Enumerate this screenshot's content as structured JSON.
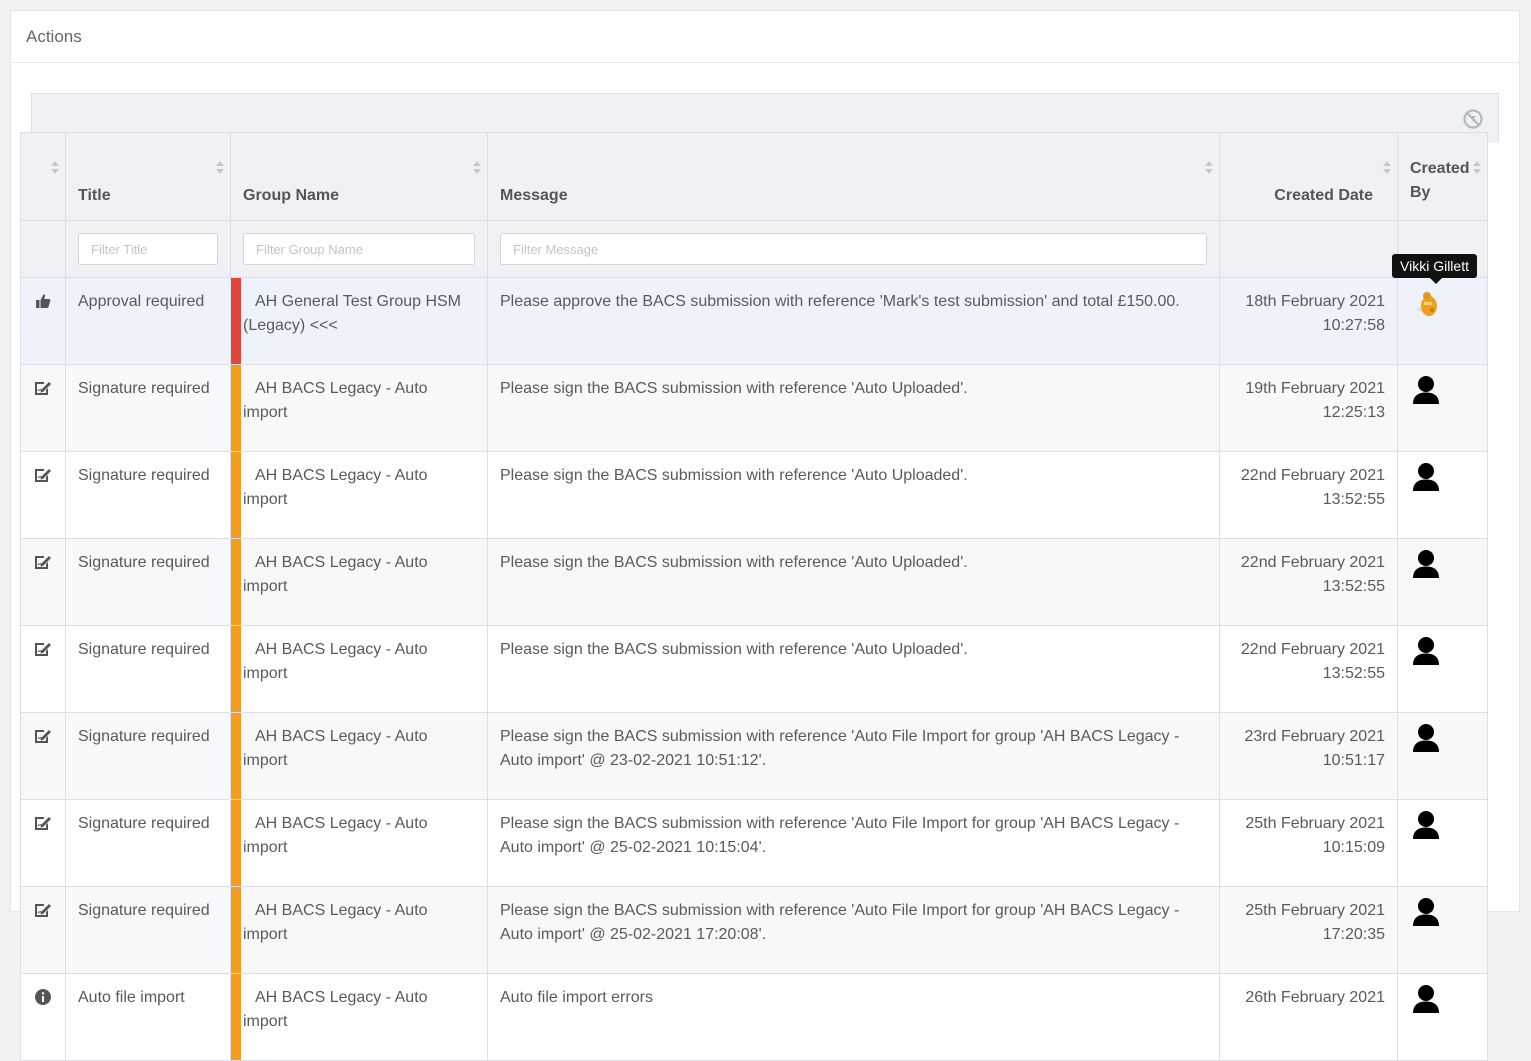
{
  "card": {
    "title": "Actions"
  },
  "columns": {
    "title": "Title",
    "group": "Group Name",
    "message": "Message",
    "created_date": "Created Date",
    "created_by": "Created By"
  },
  "filters": {
    "title_placeholder": "Filter Title",
    "group_placeholder": "Filter Group Name",
    "message_placeholder": "Filter Message"
  },
  "tooltip": "Vikki Gillett",
  "colors": {
    "red": "#e2453c",
    "orange": "#f39c1f"
  },
  "rows": [
    {
      "icon": "thumbs-up-icon",
      "title": "Approval required",
      "group": "AH General Test Group HSM (Legacy) <<<",
      "group_color": "red",
      "message": "Please approve the BACS submission with reference 'Mark's test submission' and total £150.00.",
      "date": "18th February 2021",
      "time": "10:27:58",
      "avatar": "vikki-avatar-icon"
    },
    {
      "icon": "signature-icon",
      "title": "Signature required",
      "group": "AH BACS Legacy - Auto import",
      "group_color": "orange",
      "message": "Please sign the BACS submission with reference 'Auto Uploaded'.",
      "date": "19th February 2021",
      "time": "12:25:13",
      "avatar": "user-icon"
    },
    {
      "icon": "signature-icon",
      "title": "Signature required",
      "group": "AH BACS Legacy - Auto import",
      "group_color": "orange",
      "message": "Please sign the BACS submission with reference 'Auto Uploaded'.",
      "date": "22nd February 2021",
      "time": "13:52:55",
      "avatar": "user-icon"
    },
    {
      "icon": "signature-icon",
      "title": "Signature required",
      "group": "AH BACS Legacy - Auto import",
      "group_color": "orange",
      "message": "Please sign the BACS submission with reference 'Auto Uploaded'.",
      "date": "22nd February 2021",
      "time": "13:52:55",
      "avatar": "user-icon"
    },
    {
      "icon": "signature-icon",
      "title": "Signature required",
      "group": "AH BACS Legacy - Auto import",
      "group_color": "orange",
      "message": "Please sign the BACS submission with reference 'Auto Uploaded'.",
      "date": "22nd February 2021",
      "time": "13:52:55",
      "avatar": "user-icon"
    },
    {
      "icon": "signature-icon",
      "title": "Signature required",
      "group": "AH BACS Legacy - Auto import",
      "group_color": "orange",
      "message": "Please sign the BACS submission with reference 'Auto File Import for group 'AH BACS Legacy - Auto import' @ 23-02-2021 10:51:12'.",
      "date": "23rd February 2021",
      "time": "10:51:17",
      "avatar": "user-icon"
    },
    {
      "icon": "signature-icon",
      "title": "Signature required",
      "group": "AH BACS Legacy - Auto import",
      "group_color": "orange",
      "message": "Please sign the BACS submission with reference 'Auto File Import for group 'AH BACS Legacy - Auto import' @ 25-02-2021 10:15:04'.",
      "date": "25th February 2021",
      "time": "10:15:09",
      "avatar": "user-icon"
    },
    {
      "icon": "signature-icon",
      "title": "Signature required",
      "group": "AH BACS Legacy - Auto import",
      "group_color": "orange",
      "message": "Please sign the BACS submission with reference 'Auto File Import for group 'AH BACS Legacy - Auto import' @ 25-02-2021 17:20:08'.",
      "date": "25th February 2021",
      "time": "17:20:35",
      "avatar": "user-icon"
    },
    {
      "icon": "info-icon",
      "title": "Auto file import",
      "group": "AH BACS Legacy - Auto import",
      "group_color": "orange",
      "message": "Auto file import errors",
      "date": "26th February 2021",
      "time": "",
      "avatar": "user-icon"
    }
  ]
}
